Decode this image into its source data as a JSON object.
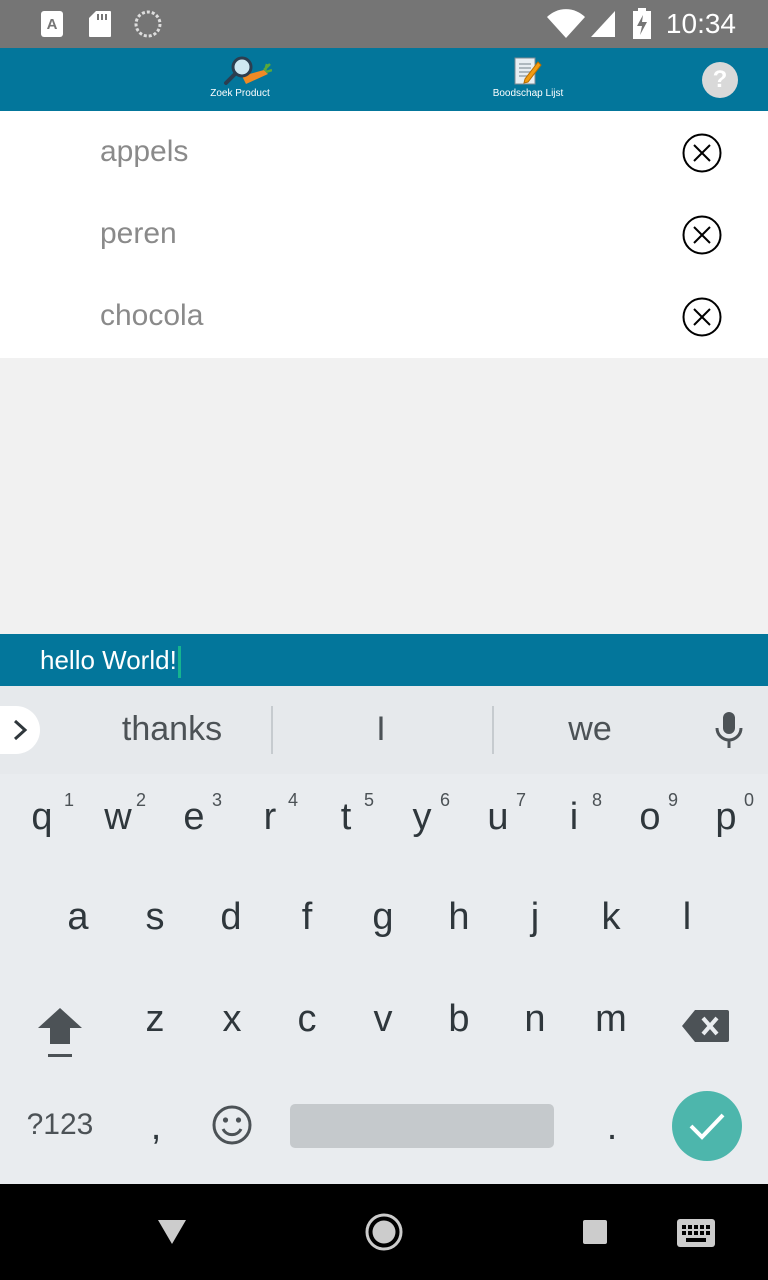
{
  "status_bar": {
    "time": "10:34",
    "icons": [
      "a-notification-icon",
      "sd-card-icon",
      "sync-icon",
      "wifi-icon",
      "cell-signal-icon",
      "battery-charging-icon"
    ]
  },
  "app_bar": {
    "tabs": [
      {
        "label": "Zoek Product",
        "icon": "magnifier-carrot-icon"
      },
      {
        "label": "Boodschap Lijst",
        "icon": "notepad-pencil-icon"
      }
    ],
    "help_label": "?"
  },
  "list": {
    "items": [
      {
        "label": "appels"
      },
      {
        "label": "peren"
      },
      {
        "label": "chocola"
      }
    ]
  },
  "input": {
    "value": "hello World!"
  },
  "keyboard": {
    "suggestions": [
      "thanks",
      "I",
      "we"
    ],
    "row1": [
      {
        "key": "q",
        "num": "1"
      },
      {
        "key": "w",
        "num": "2"
      },
      {
        "key": "e",
        "num": "3"
      },
      {
        "key": "r",
        "num": "4"
      },
      {
        "key": "t",
        "num": "5"
      },
      {
        "key": "y",
        "num": "6"
      },
      {
        "key": "u",
        "num": "7"
      },
      {
        "key": "i",
        "num": "8"
      },
      {
        "key": "o",
        "num": "9"
      },
      {
        "key": "p",
        "num": "0"
      }
    ],
    "row2": [
      "a",
      "s",
      "d",
      "f",
      "g",
      "h",
      "j",
      "k",
      "l"
    ],
    "row3": [
      "z",
      "x",
      "c",
      "v",
      "b",
      "n",
      "m"
    ],
    "symbols_label": "?123",
    "comma": ",",
    "period": ".",
    "colors": {
      "accent": "#4db6ac",
      "bar": "#03769b"
    }
  }
}
